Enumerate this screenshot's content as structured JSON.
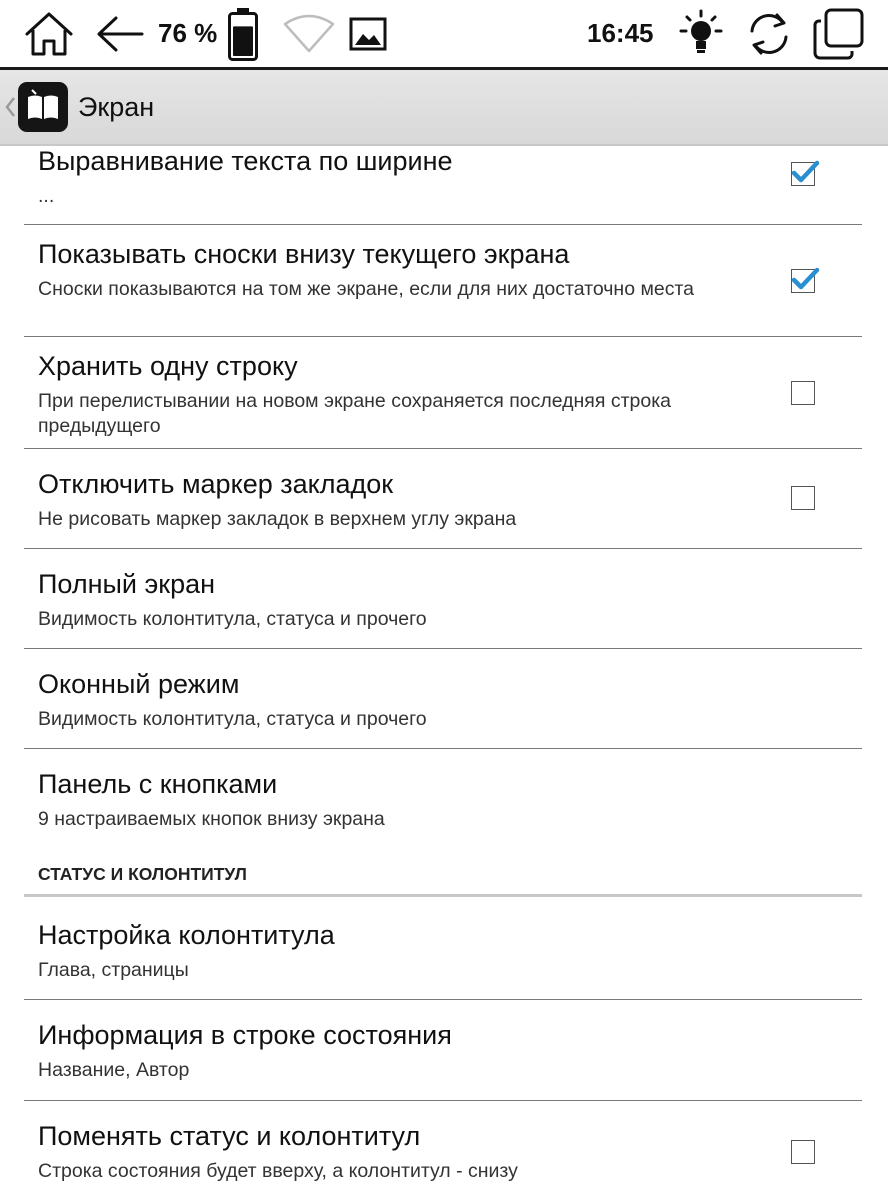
{
  "status_bar": {
    "battery_percent": "76 %",
    "battery_level": 0.76,
    "time": "16:45",
    "icons": [
      "home-icon",
      "back-arrow-icon",
      "battery-icon",
      "wifi-icon",
      "image-icon",
      "frontlight-icon",
      "refresh-icon",
      "window-switch-icon"
    ]
  },
  "title_bar": {
    "title": "Экран",
    "icon": "book-app-icon"
  },
  "preferences": [
    {
      "title": "Выравнивание текста по ширине",
      "summary": "...",
      "checkbox": true,
      "checked": true
    },
    {
      "title": "Показывать сноски внизу текущего экрана",
      "summary": "Сноски показываются на том же экране, если для них достаточно места",
      "checkbox": true,
      "checked": true
    },
    {
      "title": "Хранить одну строку",
      "summary": "При перелистывании на новом экране сохраняется последняя строка предыдущего",
      "checkbox": true,
      "checked": false
    },
    {
      "title": "Отключить маркер закладок",
      "summary": "Не рисовать маркер закладок в верхнем углу экрана",
      "checkbox": true,
      "checked": false
    },
    {
      "title": "Полный экран",
      "summary": "Видимость колонтитула, статуса и прочего",
      "checkbox": false
    },
    {
      "title": "Оконный режим",
      "summary": "Видимость колонтитула, статуса и прочего",
      "checkbox": false
    },
    {
      "title": "Панель с кнопками",
      "summary": "9 настраиваемых кнопок внизу экрана",
      "checkbox": false
    }
  ],
  "section": {
    "header": "СТАТУС И КОЛОНТИТУЛ",
    "items": [
      {
        "title": "Настройка колонтитула",
        "summary": "Глава, страницы",
        "checkbox": false
      },
      {
        "title": "Информация в строке состояния",
        "summary": "Название, Автор",
        "checkbox": false
      },
      {
        "title": "Поменять статус и колонтитул",
        "summary": "Строка состояния будет вверху, а колонтитул - снизу",
        "checkbox": true,
        "checked": false
      }
    ]
  },
  "colors": {
    "check_blue": "#2a8fd0",
    "title_bar_bg": "#dedede"
  }
}
